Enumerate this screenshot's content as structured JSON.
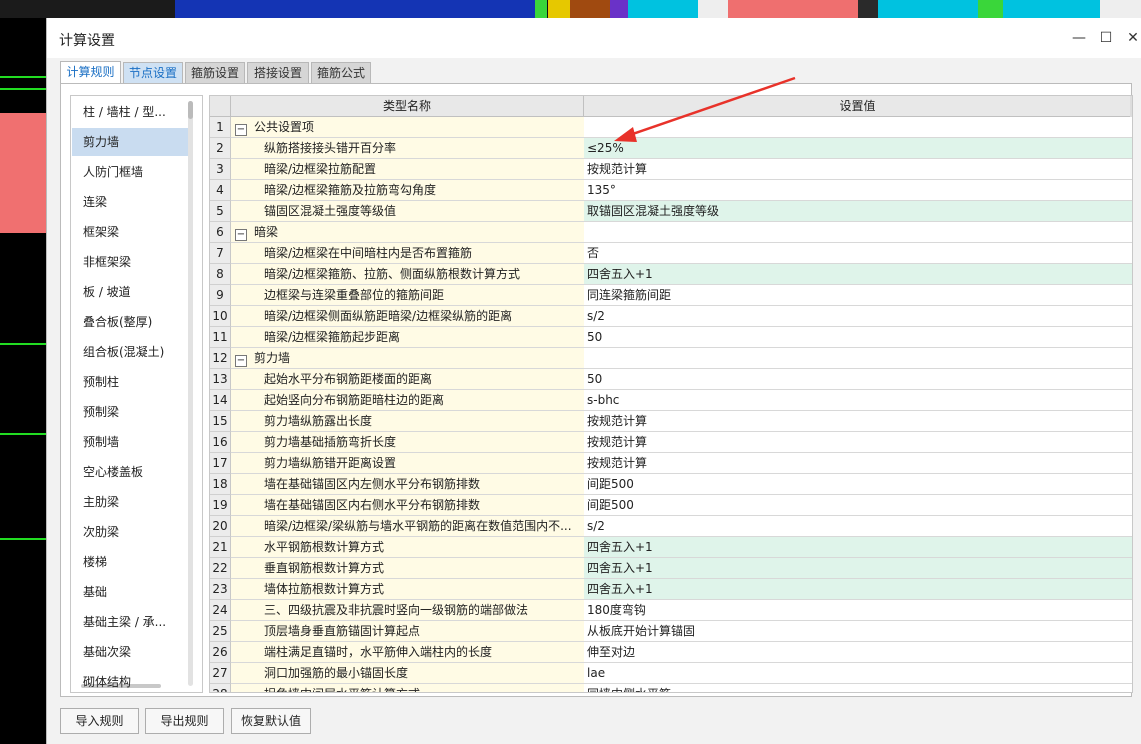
{
  "dialog": {
    "title": "计算设置"
  },
  "window_controls": {
    "minimize": "—",
    "maximize": "☐",
    "close": "✕"
  },
  "tabs": [
    "计算规则",
    "节点设置",
    "箍筋设置",
    "搭接设置",
    "箍筋公式"
  ],
  "active_tab": "计算规则",
  "sidebar": {
    "items": [
      "柱 / 墙柱 / 型...",
      "剪力墙",
      "人防门框墙",
      "连梁",
      "框架梁",
      "非框架梁",
      "板 / 坡道",
      "叠合板(整厚)",
      "组合板(混凝土)",
      "预制柱",
      "预制梁",
      "预制墙",
      "空心楼盖板",
      "主肋梁",
      "次肋梁",
      "楼梯",
      "基础",
      "基础主梁 / 承...",
      "基础次梁",
      "砌体结构"
    ],
    "selected": "剪力墙"
  },
  "grid": {
    "headers": {
      "name": "类型名称",
      "value": "设置值"
    },
    "rows": [
      {
        "num": "1",
        "name": "公共设置项",
        "value": "",
        "group": true,
        "toggle": "−"
      },
      {
        "num": "2",
        "name": "纵筋搭接接头错开百分率",
        "value": "≤25%",
        "hl": true
      },
      {
        "num": "3",
        "name": "暗梁/边框梁拉筋配置",
        "value": "按规范计算"
      },
      {
        "num": "4",
        "name": "暗梁/边框梁箍筋及拉筋弯勾角度",
        "value": "135°"
      },
      {
        "num": "5",
        "name": "锚固区混凝土强度等级值",
        "value": "取锚固区混凝土强度等级",
        "hl": true
      },
      {
        "num": "6",
        "name": "暗梁",
        "value": "",
        "group": true,
        "toggle": "−"
      },
      {
        "num": "7",
        "name": "暗梁/边框梁在中间暗柱内是否布置箍筋",
        "value": "否"
      },
      {
        "num": "8",
        "name": "暗梁/边框梁箍筋、拉筋、侧面纵筋根数计算方式",
        "value": "四舍五入+1",
        "hl": true
      },
      {
        "num": "9",
        "name": "边框梁与连梁重叠部位的箍筋间距",
        "value": "同连梁箍筋间距"
      },
      {
        "num": "10",
        "name": "暗梁/边框梁侧面纵筋距暗梁/边框梁纵筋的距离",
        "value": "s/2"
      },
      {
        "num": "11",
        "name": "暗梁/边框梁箍筋起步距离",
        "value": "50"
      },
      {
        "num": "12",
        "name": "剪力墙",
        "value": "",
        "group": true,
        "toggle": "−"
      },
      {
        "num": "13",
        "name": "起始水平分布钢筋距楼面的距离",
        "value": "50"
      },
      {
        "num": "14",
        "name": "起始竖向分布钢筋距暗柱边的距离",
        "value": "s-bhc"
      },
      {
        "num": "15",
        "name": "剪力墙纵筋露出长度",
        "value": "按规范计算"
      },
      {
        "num": "16",
        "name": "剪力墙基础插筋弯折长度",
        "value": "按规范计算"
      },
      {
        "num": "17",
        "name": "剪力墙纵筋错开距离设置",
        "value": "按规范计算"
      },
      {
        "num": "18",
        "name": "墙在基础锚固区内左侧水平分布钢筋排数",
        "value": "间距500"
      },
      {
        "num": "19",
        "name": "墙在基础锚固区内右侧水平分布钢筋排数",
        "value": "间距500"
      },
      {
        "num": "20",
        "name": "暗梁/边框梁/梁纵筋与墙水平钢筋的距离在数值范围内不...",
        "value": "s/2"
      },
      {
        "num": "21",
        "name": "水平钢筋根数计算方式",
        "value": "四舍五入+1",
        "hl": true
      },
      {
        "num": "22",
        "name": "垂直钢筋根数计算方式",
        "value": "四舍五入+1",
        "hl": true
      },
      {
        "num": "23",
        "name": "墙体拉筋根数计算方式",
        "value": "四舍五入+1",
        "hl": true
      },
      {
        "num": "24",
        "name": "三、四级抗震及非抗震时竖向一级钢筋的端部做法",
        "value": "180度弯钩"
      },
      {
        "num": "25",
        "name": "顶层墙身垂直筋锚固计算起点",
        "value": "从板底开始计算锚固"
      },
      {
        "num": "26",
        "name": "端柱满足直锚时，水平筋伸入端柱内的长度",
        "value": "伸至对边"
      },
      {
        "num": "27",
        "name": "洞口加强筋的最小锚固长度",
        "value": "lae"
      },
      {
        "num": "28",
        "name": "拐角墙中间层水平筋计算方式",
        "value": "同墙内侧水平筋"
      }
    ]
  },
  "buttons": {
    "import": "导入规则",
    "export": "导出规则",
    "reset": "恢复默认值"
  },
  "colors": {
    "highlight_row": "#dff4ea",
    "name_cell": "#fffbe5",
    "selected_side": "#c9dcf0",
    "arrow": "#e8322a",
    "active_tab_text": "#1a6fc4"
  }
}
